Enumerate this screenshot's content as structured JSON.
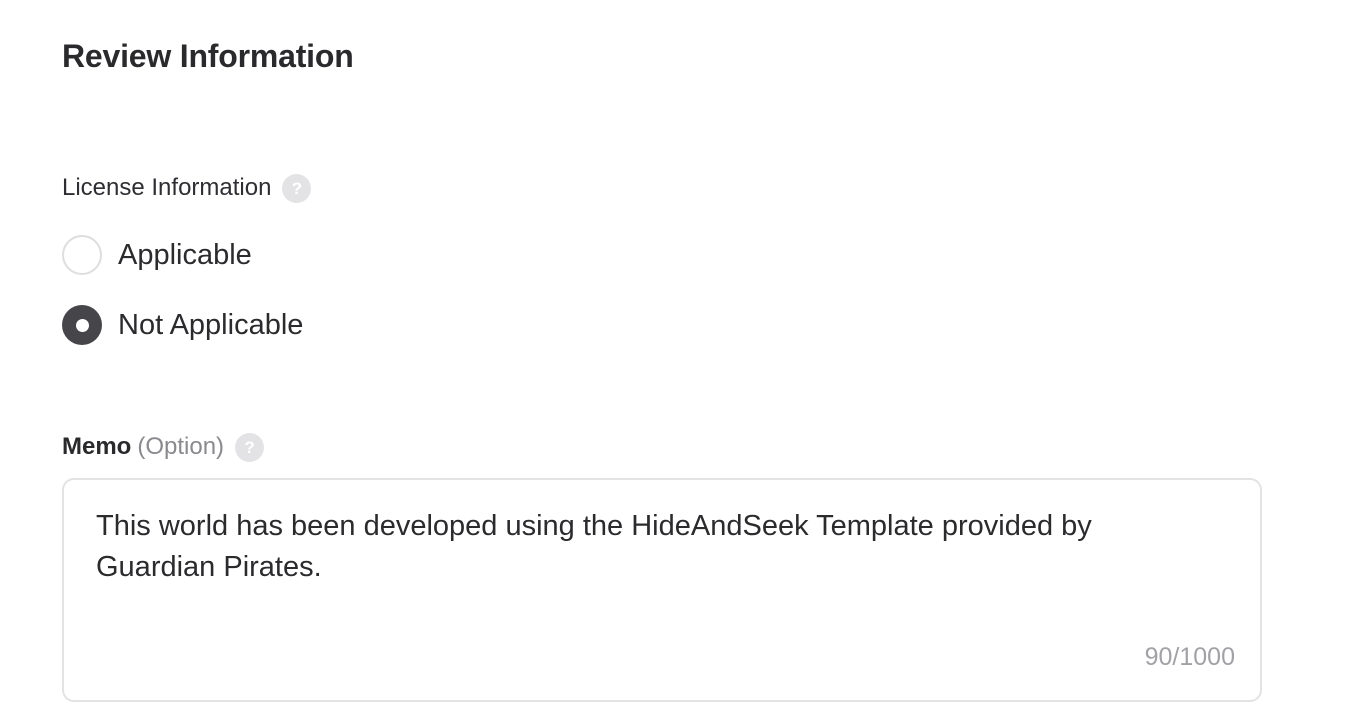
{
  "page": {
    "title": "Review Information"
  },
  "license": {
    "label": "License Information",
    "help_icon": "question-mark-icon",
    "help_glyph": "?",
    "options": [
      {
        "label": "Applicable",
        "checked": false
      },
      {
        "label": "Not Applicable",
        "checked": true
      }
    ]
  },
  "memo": {
    "label": "Memo",
    "optional_label": "(Option)",
    "help_icon": "question-mark-icon",
    "help_glyph": "?",
    "value": "This world has been developed using the HideAndSeek Template provided by Guardian Pirates.",
    "counter": "90/1000"
  },
  "colors": {
    "radio_checked": "#45454a",
    "radio_border": "#dedee1",
    "help_icon_bg": "#e3e3e5",
    "counter_text": "#a2a2a6",
    "optional_text": "#8a8a8e"
  }
}
